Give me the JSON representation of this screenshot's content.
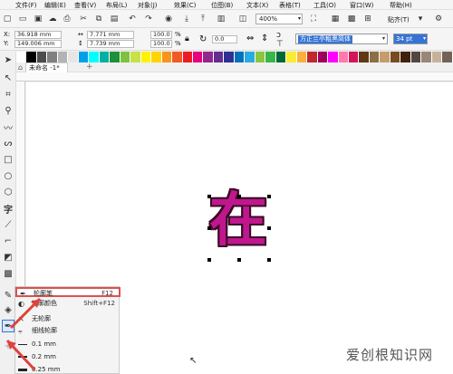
{
  "menubar": {
    "items": [
      "文件(F)",
      "编辑(E)",
      "查看(V)",
      "布局(L)",
      "对象(J)",
      "效果(C)",
      "位图(B)",
      "文本(X)",
      "表格(T)",
      "工具(O)",
      "窗口(W)",
      "帮助(H)"
    ]
  },
  "toolbar": {
    "zoom": "400%",
    "snap_label": "贴齐(T)"
  },
  "propbar": {
    "x_label": "X:",
    "x_value": "36.918 mm",
    "y_label": "Y:",
    "y_value": "149.006 mm",
    "w_value": "7.771 mm",
    "h_value": "7.739 mm",
    "scale_w": "100.0",
    "scale_h": "100.0",
    "pct": "%",
    "rotation": "0.0",
    "font_name": "方正兰亭粗黑简体",
    "font_size": "34 pt"
  },
  "palette": {
    "colors": [
      "#ffffff",
      "#000000",
      "#4d4d4d",
      "#808080",
      "#b3b3b3",
      "#e6e6e6",
      "#00a0e9",
      "#00ffff",
      "#00b0a0",
      "#1f8f3a",
      "#7fc241",
      "#c8e04a",
      "#fff200",
      "#ffd400",
      "#f7941d",
      "#f15a24",
      "#ed1c24",
      "#e6007e",
      "#92278f",
      "#662d91",
      "#2e3192",
      "#0071bc",
      "#29abe2",
      "#8cc63f",
      "#39b54a",
      "#006837",
      "#f9ed32",
      "#fbb03b",
      "#c1272d",
      "#9e005d",
      "#ff00ff",
      "#ff7bac",
      "#d4145a",
      "#603813",
      "#8b6f47",
      "#c69c6d",
      "#754c24",
      "#42210b",
      "#534741",
      "#998675",
      "#c7b299",
      "#736357"
    ]
  },
  "tabs": {
    "doc_label": "未命名 -1*",
    "add": "+"
  },
  "canvas": {
    "glyph": "在"
  },
  "flyout": {
    "items": [
      {
        "icon": "pen-nib",
        "label": "轮廓笔",
        "shortcut": "F12"
      },
      {
        "icon": "color",
        "label": "轮廓颜色",
        "shortcut": "Shift+F12"
      },
      {
        "icon": "x",
        "label": "无轮廓",
        "shortcut": ""
      },
      {
        "icon": "hairline",
        "label": "细线轮廓",
        "shortcut": ""
      },
      {
        "icon": "line-thin",
        "label": "0.1 mm",
        "shortcut": ""
      },
      {
        "icon": "line-mid",
        "label": "0.2 mm",
        "shortcut": ""
      },
      {
        "icon": "line-thick",
        "label": "0.25 mm",
        "shortcut": ""
      }
    ]
  },
  "watermark": "爱创根知识网",
  "accent": "#e0413b"
}
